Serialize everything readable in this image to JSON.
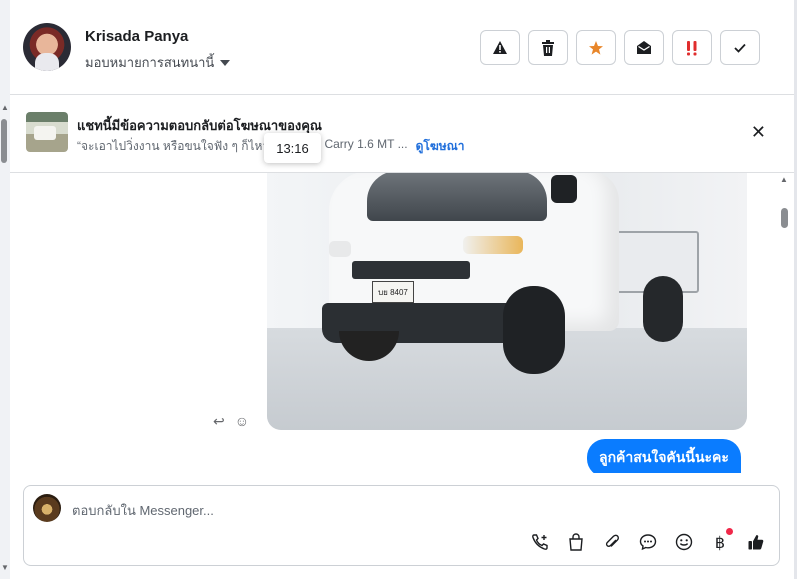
{
  "contact": {
    "name": "Krisada Panya",
    "assign_label": "มอบหมายการสนทนานี้"
  },
  "header_actions": [
    {
      "name": "warning-button",
      "icon": "warning-icon",
      "glyph": "⚠"
    },
    {
      "name": "delete-button",
      "icon": "trash-icon",
      "glyph": "🗑"
    },
    {
      "name": "star-button",
      "icon": "star-icon",
      "glyph": "★",
      "color": "#e8862a"
    },
    {
      "name": "mark-unread-button",
      "icon": "envelope-open-icon",
      "glyph": "✉"
    },
    {
      "name": "priority-button",
      "icon": "double-exclamation-icon",
      "glyph": "‼",
      "color": "#e02d2d"
    },
    {
      "name": "done-button",
      "icon": "check-icon",
      "glyph": "✓"
    }
  ],
  "ad_banner": {
    "title": "แชทนี้มีข้อความตอบกลับต่อโฆษณาของคุณ",
    "quote": "“จะเอาไปวิ่งงาน หรือขนใจฟัง ๆ ก็ไหวห",
    "quote_tail": "Suzuki Carry 1.6 MT ...",
    "link": "ดูโฆษณา"
  },
  "tooltip_time": "13:16",
  "messages": [
    {
      "type": "image",
      "direction": "incoming",
      "alt": "white Suzuki Carry pickup",
      "plate_text": "บย 8407"
    },
    {
      "type": "text",
      "direction": "outgoing",
      "text": "ลูกค้าสนใจคันนี้นะคะ"
    }
  ],
  "composer": {
    "placeholder": "ตอบกลับใน Messenger...",
    "tools": [
      "phone-plus-icon",
      "shopping-bag-icon",
      "paperclip-icon",
      "speech-bubble-icon",
      "smiley-icon",
      "baht-icon",
      "thumbs-up-icon"
    ]
  },
  "colors": {
    "accent": "#0a7cff",
    "link": "#216fdb",
    "star": "#e8862a",
    "notification_dot": "#f02849"
  }
}
